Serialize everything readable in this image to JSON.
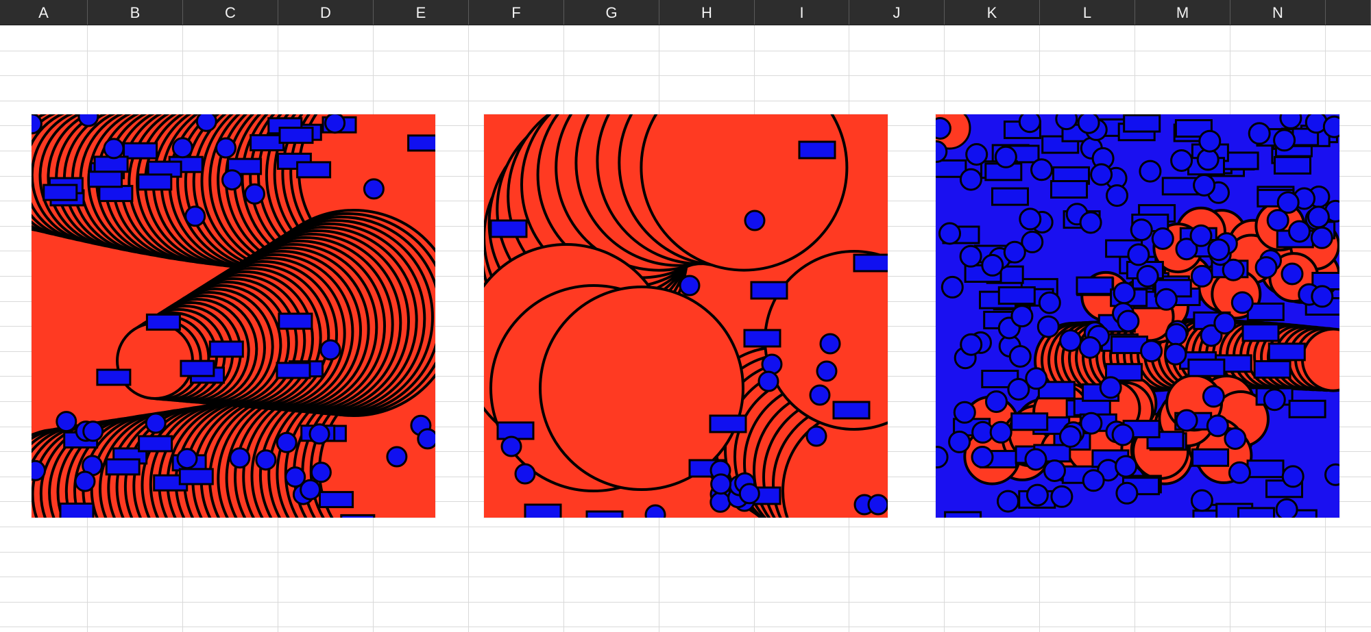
{
  "spreadsheet": {
    "columns": [
      "A",
      "B",
      "C",
      "D",
      "E",
      "F",
      "G",
      "H",
      "I",
      "J",
      "K",
      "L",
      "M",
      "N"
    ],
    "row_count": 25
  },
  "pictures": [
    {
      "name": "picture-1",
      "background": "#ff3a22",
      "style": "red circle spiral swirl with blue markers"
    },
    {
      "name": "picture-2",
      "background": "#ff3a22",
      "style": "large red overlapping circles with blue markers"
    },
    {
      "name": "picture-3",
      "background": "#1a10f0",
      "style": "dense blue markers over red circle band"
    }
  ],
  "colors": {
    "header_bg": "#2d2d2d",
    "header_text": "#f2f2f2",
    "grid_line": "#d9d9d9",
    "red": "#ff3a22",
    "blue": "#1010f0",
    "outline": "#000000"
  }
}
